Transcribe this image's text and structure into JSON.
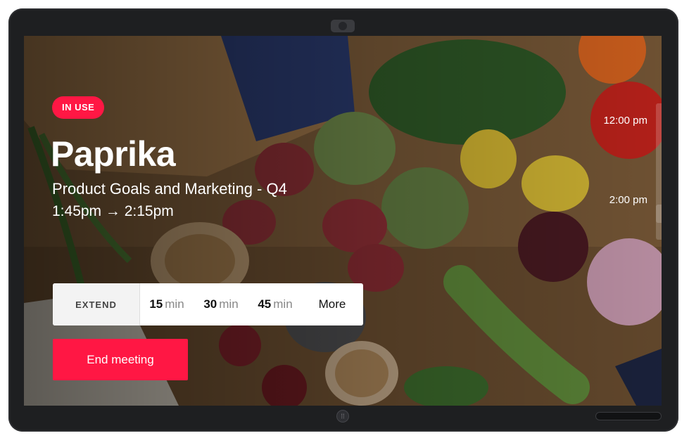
{
  "status_badge": "IN USE",
  "room_name": "Paprika",
  "meeting": {
    "title": "Product Goals and Marketing - Q4",
    "time": "1:45pm → 2:15pm"
  },
  "extend": {
    "label": "EXTEND",
    "options": [
      {
        "num": "15",
        "unit": "min"
      },
      {
        "num": "30",
        "unit": "min"
      },
      {
        "num": "45",
        "unit": "min"
      }
    ],
    "more_label": "More"
  },
  "end_meeting_label": "End meeting",
  "timeline": {
    "labels": [
      "12:00 pm",
      "2:00 pm"
    ]
  },
  "colors": {
    "accent": "#ff1744",
    "device": "#1e1f21"
  }
}
